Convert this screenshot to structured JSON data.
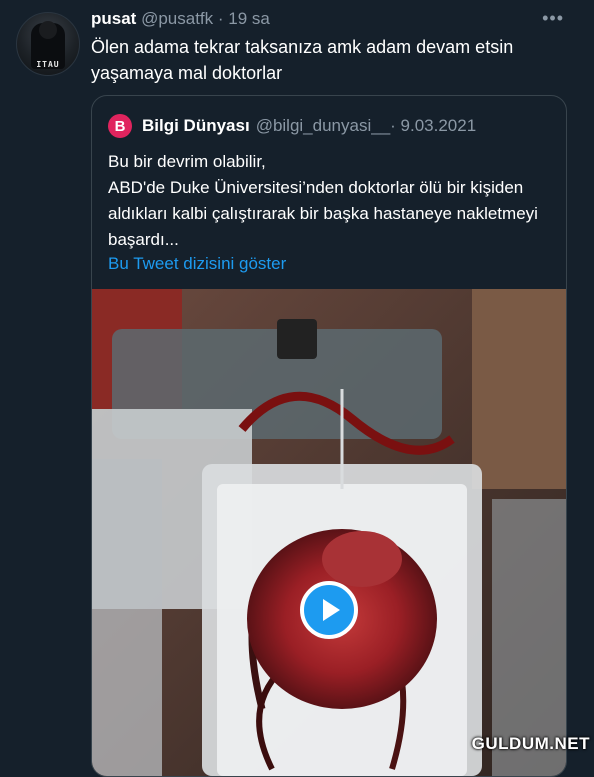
{
  "tweet": {
    "name": "pusat",
    "handle": "@pusatfk",
    "time": "· 19 sa",
    "text": "Ölen adama tekrar taksanıza amk adam devam etsin yaşamaya mal doktorlar",
    "more_icon": "more-horizontal-icon"
  },
  "quoted": {
    "logo_letter": "B",
    "name": "Bilgi Dünyası",
    "handle": "@bilgi_dunyasi__",
    "date": "· 9.03.2021",
    "text": "Bu bir devrim olabilir,\nABD'de Duke Üniversitesi’nden doktorlar ölü bir kişiden aldıkları kalbi çalıştırarak bir başka hastaneye nakletmeyi başardı...",
    "thread_link": "Bu Tweet dizisini göster"
  },
  "media": {
    "play_icon": "play-icon"
  },
  "watermark": "GULDUM.NET",
  "colors": {
    "background": "#15202b",
    "link": "#1d9bf0",
    "secondary_text": "#8b98a5",
    "border": "#38444d",
    "logo_red": "#e0245e"
  }
}
